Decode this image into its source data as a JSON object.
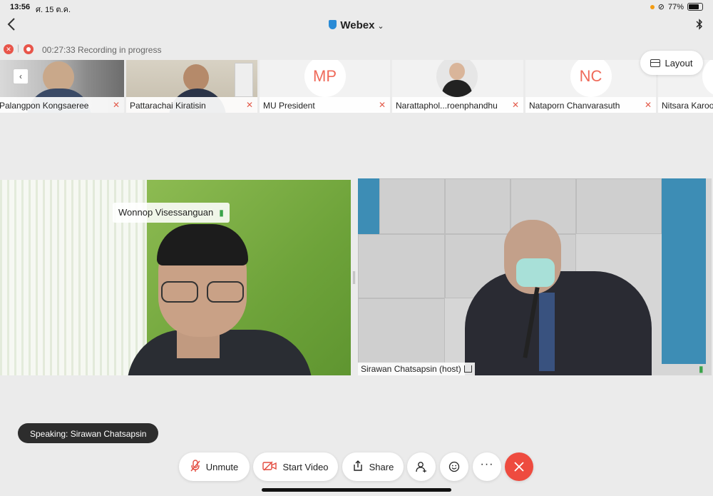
{
  "status_bar": {
    "time": "13:56",
    "date": "ศ. 15 ต.ค.",
    "battery": "77%",
    "battery_level": 0.77
  },
  "nav": {
    "title": "Webex",
    "back_icon": "chevron-left-icon",
    "bluetooth_icon": "bluetooth-icon"
  },
  "recording": {
    "text": "00:27:33 Recording in progress"
  },
  "layout_button": {
    "label": "Layout"
  },
  "participants": [
    {
      "name": "Palangpon Kongsaeree",
      "type": "video",
      "muted": true
    },
    {
      "name": "Pattarachai Kiratisin",
      "type": "video",
      "muted": true
    },
    {
      "name": "MU President",
      "type": "initials",
      "initials": "MP",
      "muted": true
    },
    {
      "name": "Narattaphol...roenphandhu",
      "type": "photo",
      "muted": true
    },
    {
      "name": "Nataporn Chanvarasuth",
      "type": "initials",
      "initials": "NC",
      "muted": true
    },
    {
      "name": "Nitsara Karoo",
      "type": "initials",
      "initials": "",
      "muted": false
    }
  ],
  "main_videos": {
    "left": {
      "name": "Wonnop Visessanguan"
    },
    "right": {
      "name": "Sirawan Chatsapsin (host)"
    }
  },
  "speaking": "Speaking: Sirawan Chatsapsin",
  "controls": {
    "unmute": "Unmute",
    "start_video": "Start Video",
    "share": "Share",
    "participants_icon": "participants-icon",
    "reactions_icon": "reactions-icon",
    "more_icon": "more-icon",
    "end_icon": "end-call-icon"
  },
  "colors": {
    "accent_red": "#ee4b3f",
    "mic_green": "#3aa34a",
    "initials_coral": "#ef6a5a"
  }
}
